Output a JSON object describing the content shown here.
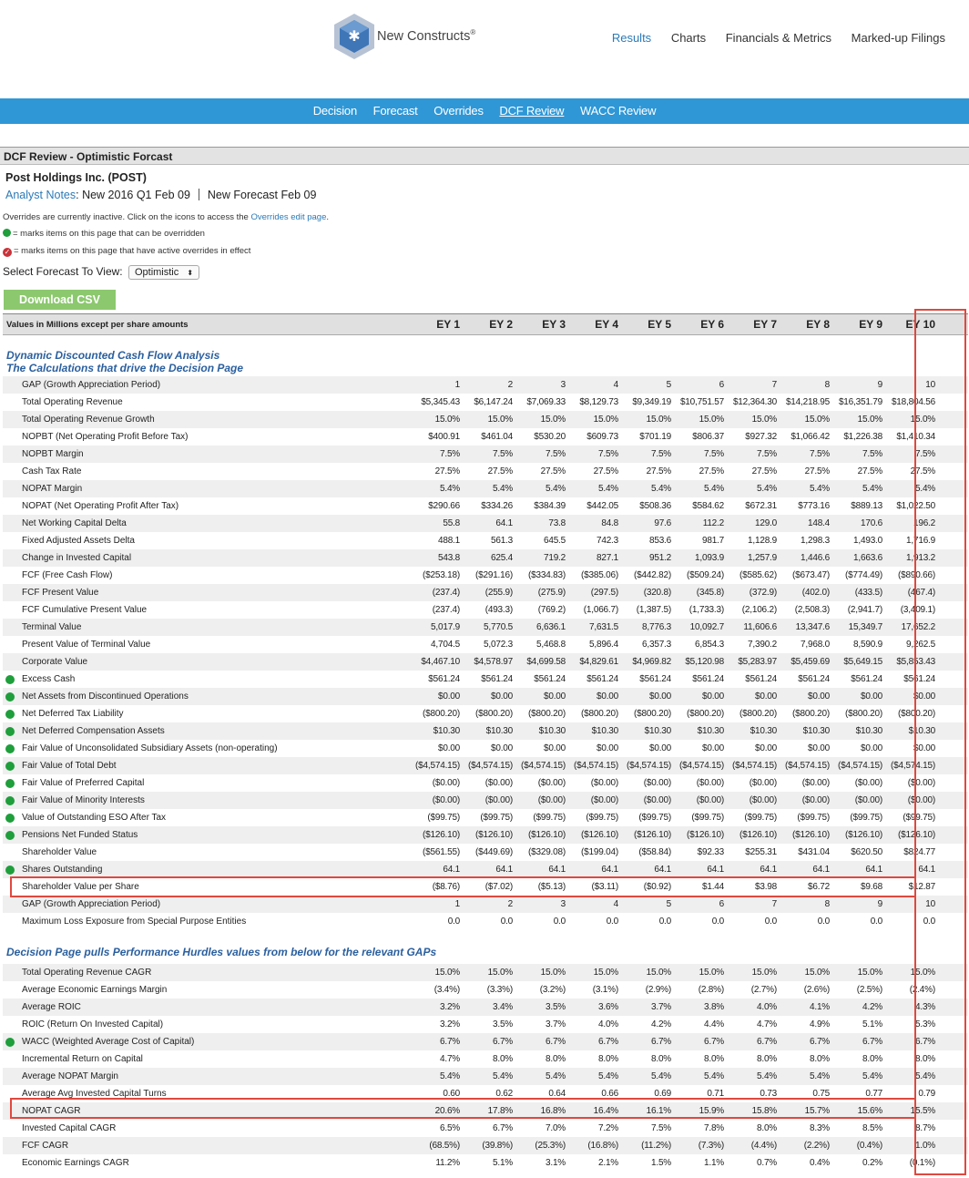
{
  "brand": {
    "name": "New Constructs",
    "trademark": "®"
  },
  "topnav": [
    "Results",
    "Charts",
    "Financials & Metrics",
    "Marked-up Filings"
  ],
  "subnav": [
    "Decision",
    "Forecast",
    "Overrides",
    "DCF Review",
    "WACC Review"
  ],
  "title": "DCF Review - Optimistic Forcast",
  "company": "Post Holdings Inc. (POST)",
  "notes": {
    "link": "Analyst Notes",
    "text": ": New 2016 Q1 Feb 09",
    "forecast": "New Forecast Feb 09"
  },
  "overrides_msg": {
    "prefix": "Overrides are currently inactive. Click on the icons to access the",
    "link": "Overrides edit page",
    "suffix": "."
  },
  "legend": {
    "green": "= marks items on this page that can be overridden",
    "red": "= marks items on this page that have active overrides in effect"
  },
  "forecast_select": {
    "label": "Select Forecast To View:",
    "value": "Optimistic"
  },
  "download_label": "Download CSV",
  "table": {
    "caption": "Values in Millions except per share amounts",
    "columns": [
      "EY 1",
      "EY 2",
      "EY 3",
      "EY 4",
      "EY 5",
      "EY 6",
      "EY 7",
      "EY 8",
      "EY 9",
      "EY 10"
    ],
    "section1": [
      "Dynamic Discounted Cash Flow Analysis",
      "The Calculations that drive the Decision Page"
    ],
    "rows1": [
      {
        "label": "GAP (Growth Appreciation Period)",
        "dot": false,
        "values": [
          "1",
          "2",
          "3",
          "4",
          "5",
          "6",
          "7",
          "8",
          "9",
          "10"
        ]
      },
      {
        "label": "Total Operating Revenue",
        "dot": false,
        "values": [
          "$5,345.43",
          "$6,147.24",
          "$7,069.33",
          "$8,129.73",
          "$9,349.19",
          "$10,751.57",
          "$12,364.30",
          "$14,218.95",
          "$16,351.79",
          "$18,804.56"
        ]
      },
      {
        "label": "Total Operating Revenue Growth",
        "dot": false,
        "values": [
          "15.0%",
          "15.0%",
          "15.0%",
          "15.0%",
          "15.0%",
          "15.0%",
          "15.0%",
          "15.0%",
          "15.0%",
          "15.0%"
        ]
      },
      {
        "label": "NOPBT (Net Operating Profit Before Tax)",
        "dot": false,
        "values": [
          "$400.91",
          "$461.04",
          "$530.20",
          "$609.73",
          "$701.19",
          "$806.37",
          "$927.32",
          "$1,066.42",
          "$1,226.38",
          "$1,410.34"
        ]
      },
      {
        "label": "NOPBT Margin",
        "dot": false,
        "values": [
          "7.5%",
          "7.5%",
          "7.5%",
          "7.5%",
          "7.5%",
          "7.5%",
          "7.5%",
          "7.5%",
          "7.5%",
          "7.5%"
        ]
      },
      {
        "label": "Cash Tax Rate",
        "dot": false,
        "values": [
          "27.5%",
          "27.5%",
          "27.5%",
          "27.5%",
          "27.5%",
          "27.5%",
          "27.5%",
          "27.5%",
          "27.5%",
          "27.5%"
        ]
      },
      {
        "label": "NOPAT Margin",
        "dot": false,
        "values": [
          "5.4%",
          "5.4%",
          "5.4%",
          "5.4%",
          "5.4%",
          "5.4%",
          "5.4%",
          "5.4%",
          "5.4%",
          "5.4%"
        ]
      },
      {
        "label": "NOPAT (Net Operating Profit After Tax)",
        "dot": false,
        "values": [
          "$290.66",
          "$334.26",
          "$384.39",
          "$442.05",
          "$508.36",
          "$584.62",
          "$672.31",
          "$773.16",
          "$889.13",
          "$1,022.50"
        ]
      },
      {
        "label": "Net Working Capital Delta",
        "dot": false,
        "values": [
          "55.8",
          "64.1",
          "73.8",
          "84.8",
          "97.6",
          "112.2",
          "129.0",
          "148.4",
          "170.6",
          "196.2"
        ]
      },
      {
        "label": "Fixed Adjusted Assets Delta",
        "dot": false,
        "values": [
          "488.1",
          "561.3",
          "645.5",
          "742.3",
          "853.6",
          "981.7",
          "1,128.9",
          "1,298.3",
          "1,493.0",
          "1,716.9"
        ]
      },
      {
        "label": "Change in Invested Capital",
        "dot": false,
        "values": [
          "543.8",
          "625.4",
          "719.2",
          "827.1",
          "951.2",
          "1,093.9",
          "1,257.9",
          "1,446.6",
          "1,663.6",
          "1,913.2"
        ]
      },
      {
        "label": "FCF (Free Cash Flow)",
        "dot": false,
        "values": [
          "($253.18)",
          "($291.16)",
          "($334.83)",
          "($385.06)",
          "($442.82)",
          "($509.24)",
          "($585.62)",
          "($673.47)",
          "($774.49)",
          "($890.66)"
        ]
      },
      {
        "label": "FCF Present Value",
        "dot": false,
        "values": [
          "(237.4)",
          "(255.9)",
          "(275.9)",
          "(297.5)",
          "(320.8)",
          "(345.8)",
          "(372.9)",
          "(402.0)",
          "(433.5)",
          "(467.4)"
        ]
      },
      {
        "label": "FCF Cumulative Present Value",
        "dot": false,
        "values": [
          "(237.4)",
          "(493.3)",
          "(769.2)",
          "(1,066.7)",
          "(1,387.5)",
          "(1,733.3)",
          "(2,106.2)",
          "(2,508.3)",
          "(2,941.7)",
          "(3,409.1)"
        ]
      },
      {
        "label": "Terminal Value",
        "dot": false,
        "values": [
          "5,017.9",
          "5,770.5",
          "6,636.1",
          "7,631.5",
          "8,776.3",
          "10,092.7",
          "11,606.6",
          "13,347.6",
          "15,349.7",
          "17,652.2"
        ]
      },
      {
        "label": "Present Value of Terminal Value",
        "dot": false,
        "values": [
          "4,704.5",
          "5,072.3",
          "5,468.8",
          "5,896.4",
          "6,357.3",
          "6,854.3",
          "7,390.2",
          "7,968.0",
          "8,590.9",
          "9,262.5"
        ]
      },
      {
        "label": "Corporate Value",
        "dot": false,
        "values": [
          "$4,467.10",
          "$4,578.97",
          "$4,699.58",
          "$4,829.61",
          "$4,969.82",
          "$5,120.98",
          "$5,283.97",
          "$5,459.69",
          "$5,649.15",
          "$5,853.43"
        ]
      },
      {
        "label": "Excess Cash",
        "dot": true,
        "values": [
          "$561.24",
          "$561.24",
          "$561.24",
          "$561.24",
          "$561.24",
          "$561.24",
          "$561.24",
          "$561.24",
          "$561.24",
          "$561.24"
        ]
      },
      {
        "label": "Net Assets from Discontinued Operations",
        "dot": true,
        "values": [
          "$0.00",
          "$0.00",
          "$0.00",
          "$0.00",
          "$0.00",
          "$0.00",
          "$0.00",
          "$0.00",
          "$0.00",
          "$0.00"
        ]
      },
      {
        "label": "Net Deferred Tax Liability",
        "dot": true,
        "values": [
          "($800.20)",
          "($800.20)",
          "($800.20)",
          "($800.20)",
          "($800.20)",
          "($800.20)",
          "($800.20)",
          "($800.20)",
          "($800.20)",
          "($800.20)"
        ]
      },
      {
        "label": "Net Deferred Compensation Assets",
        "dot": true,
        "values": [
          "$10.30",
          "$10.30",
          "$10.30",
          "$10.30",
          "$10.30",
          "$10.30",
          "$10.30",
          "$10.30",
          "$10.30",
          "$10.30"
        ]
      },
      {
        "label": "Fair Value of Unconsolidated Subsidiary Assets (non-operating)",
        "dot": true,
        "values": [
          "$0.00",
          "$0.00",
          "$0.00",
          "$0.00",
          "$0.00",
          "$0.00",
          "$0.00",
          "$0.00",
          "$0.00",
          "$0.00"
        ]
      },
      {
        "label": "Fair Value of Total Debt",
        "dot": true,
        "values": [
          "($4,574.15)",
          "($4,574.15)",
          "($4,574.15)",
          "($4,574.15)",
          "($4,574.15)",
          "($4,574.15)",
          "($4,574.15)",
          "($4,574.15)",
          "($4,574.15)",
          "($4,574.15)"
        ]
      },
      {
        "label": "Fair Value of Preferred Capital",
        "dot": true,
        "values": [
          "($0.00)",
          "($0.00)",
          "($0.00)",
          "($0.00)",
          "($0.00)",
          "($0.00)",
          "($0.00)",
          "($0.00)",
          "($0.00)",
          "($0.00)"
        ]
      },
      {
        "label": "Fair Value of Minority Interests",
        "dot": true,
        "values": [
          "($0.00)",
          "($0.00)",
          "($0.00)",
          "($0.00)",
          "($0.00)",
          "($0.00)",
          "($0.00)",
          "($0.00)",
          "($0.00)",
          "($0.00)"
        ]
      },
      {
        "label": "Value of Outstanding ESO After Tax",
        "dot": true,
        "values": [
          "($99.75)",
          "($99.75)",
          "($99.75)",
          "($99.75)",
          "($99.75)",
          "($99.75)",
          "($99.75)",
          "($99.75)",
          "($99.75)",
          "($99.75)"
        ]
      },
      {
        "label": "Pensions Net Funded Status",
        "dot": true,
        "values": [
          "($126.10)",
          "($126.10)",
          "($126.10)",
          "($126.10)",
          "($126.10)",
          "($126.10)",
          "($126.10)",
          "($126.10)",
          "($126.10)",
          "($126.10)"
        ]
      },
      {
        "label": "Shareholder Value",
        "dot": false,
        "values": [
          "($561.55)",
          "($449.69)",
          "($329.08)",
          "($199.04)",
          "($58.84)",
          "$92.33",
          "$255.31",
          "$431.04",
          "$620.50",
          "$824.77"
        ]
      },
      {
        "label": "Shares Outstanding",
        "dot": true,
        "values": [
          "64.1",
          "64.1",
          "64.1",
          "64.1",
          "64.1",
          "64.1",
          "64.1",
          "64.1",
          "64.1",
          "64.1"
        ]
      },
      {
        "label": "Shareholder Value per Share",
        "dot": false,
        "values": [
          "($8.76)",
          "($7.02)",
          "($5.13)",
          "($3.11)",
          "($0.92)",
          "$1.44",
          "$3.98",
          "$6.72",
          "$9.68",
          "$12.87"
        ]
      },
      {
        "label": "GAP (Growth Appreciation Period)",
        "dot": false,
        "values": [
          "1",
          "2",
          "3",
          "4",
          "5",
          "6",
          "7",
          "8",
          "9",
          "10"
        ]
      },
      {
        "label": "Maximum Loss Exposure from Special Purpose Entities",
        "dot": false,
        "values": [
          "0.0",
          "0.0",
          "0.0",
          "0.0",
          "0.0",
          "0.0",
          "0.0",
          "0.0",
          "0.0",
          "0.0"
        ]
      }
    ],
    "section2": "Decision Page pulls Performance Hurdles values from below for the relevant GAPs",
    "rows2": [
      {
        "label": "Total Operating Revenue CAGR",
        "dot": false,
        "values": [
          "15.0%",
          "15.0%",
          "15.0%",
          "15.0%",
          "15.0%",
          "15.0%",
          "15.0%",
          "15.0%",
          "15.0%",
          "15.0%"
        ]
      },
      {
        "label": "Average Economic Earnings Margin",
        "dot": false,
        "values": [
          "(3.4%)",
          "(3.3%)",
          "(3.2%)",
          "(3.1%)",
          "(2.9%)",
          "(2.8%)",
          "(2.7%)",
          "(2.6%)",
          "(2.5%)",
          "(2.4%)"
        ]
      },
      {
        "label": "Average ROIC",
        "dot": false,
        "values": [
          "3.2%",
          "3.4%",
          "3.5%",
          "3.6%",
          "3.7%",
          "3.8%",
          "4.0%",
          "4.1%",
          "4.2%",
          "4.3%"
        ]
      },
      {
        "label": "ROIC (Return On Invested Capital)",
        "dot": false,
        "values": [
          "3.2%",
          "3.5%",
          "3.7%",
          "4.0%",
          "4.2%",
          "4.4%",
          "4.7%",
          "4.9%",
          "5.1%",
          "5.3%"
        ]
      },
      {
        "label": "WACC (Weighted Average Cost of Capital)",
        "dot": true,
        "values": [
          "6.7%",
          "6.7%",
          "6.7%",
          "6.7%",
          "6.7%",
          "6.7%",
          "6.7%",
          "6.7%",
          "6.7%",
          "6.7%"
        ]
      },
      {
        "label": "Incremental Return on Capital",
        "dot": false,
        "values": [
          "4.7%",
          "8.0%",
          "8.0%",
          "8.0%",
          "8.0%",
          "8.0%",
          "8.0%",
          "8.0%",
          "8.0%",
          "8.0%"
        ]
      },
      {
        "label": "Average NOPAT Margin",
        "dot": false,
        "values": [
          "5.4%",
          "5.4%",
          "5.4%",
          "5.4%",
          "5.4%",
          "5.4%",
          "5.4%",
          "5.4%",
          "5.4%",
          "5.4%"
        ]
      },
      {
        "label": "Average Avg Invested Capital Turns",
        "dot": false,
        "values": [
          "0.60",
          "0.62",
          "0.64",
          "0.66",
          "0.69",
          "0.71",
          "0.73",
          "0.75",
          "0.77",
          "0.79"
        ]
      },
      {
        "label": "NOPAT CAGR",
        "dot": false,
        "values": [
          "20.6%",
          "17.8%",
          "16.8%",
          "16.4%",
          "16.1%",
          "15.9%",
          "15.8%",
          "15.7%",
          "15.6%",
          "15.5%"
        ]
      },
      {
        "label": "Invested Capital CAGR",
        "dot": false,
        "values": [
          "6.5%",
          "6.7%",
          "7.0%",
          "7.2%",
          "7.5%",
          "7.8%",
          "8.0%",
          "8.3%",
          "8.5%",
          "8.7%"
        ]
      },
      {
        "label": "FCF CAGR",
        "dot": false,
        "values": [
          "(68.5%)",
          "(39.8%)",
          "(25.3%)",
          "(16.8%)",
          "(11.2%)",
          "(7.3%)",
          "(4.4%)",
          "(2.2%)",
          "(0.4%)",
          "1.0%"
        ]
      },
      {
        "label": "Economic Earnings CAGR",
        "dot": false,
        "values": [
          "11.2%",
          "5.1%",
          "3.1%",
          "2.1%",
          "1.5%",
          "1.1%",
          "0.7%",
          "0.4%",
          "0.2%",
          "(0.1%)"
        ]
      }
    ]
  }
}
